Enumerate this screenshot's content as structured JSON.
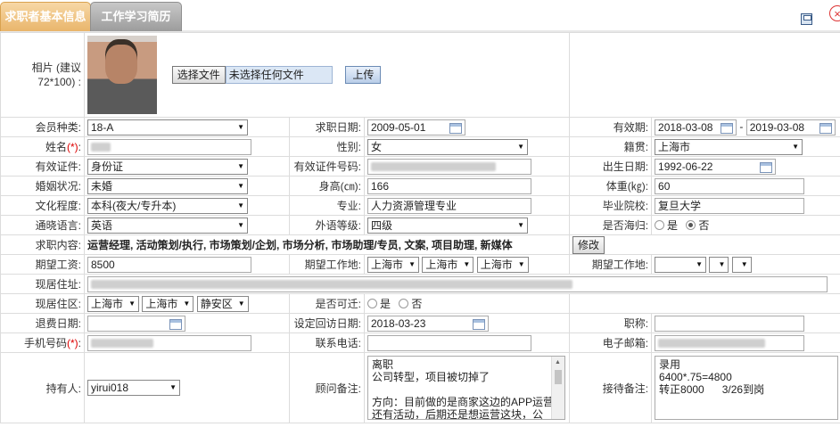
{
  "tabs": [
    "求职者基本信息",
    "工作学习简历"
  ],
  "photo": {
    "label": "相片 (建议72*100) :",
    "choose_btn": "选择文件",
    "no_file": "未选择任何文件",
    "upload_btn": "上传"
  },
  "labels": {
    "member_type": "会员种类:",
    "job_date": "求职日期:",
    "valid_period": "有效期:",
    "name": "姓名",
    "gender": "性别:",
    "native": "籍贯:",
    "id_type": "有效证件:",
    "id_no": "有效证件号码:",
    "birth": "出生日期:",
    "marital": "婚姻状况:",
    "height": "身高(㎝):",
    "weight": "体重(㎏):",
    "education": "文化程度:",
    "major": "专业:",
    "school": "毕业院校:",
    "language": "通晓语言:",
    "foreign_level": "外语等级:",
    "returnee": "是否海归:",
    "job_content": "求职内容:",
    "expect_salary": "期望工资:",
    "expect_place": "期望工作地:",
    "current_addr": "现居住址:",
    "current_area": "现居住区:",
    "relocate": "是否可迁:",
    "refund_date": "退费日期:",
    "callback_date": "设定回访日期:",
    "title": "职称:",
    "mobile": "手机号码",
    "phone": "联系电话:",
    "email": "电子邮箱:",
    "holder": "持有人:",
    "consultant_note": "顾问备注:",
    "reception_note": "接待备注:"
  },
  "values": {
    "member_type": "18-A",
    "job_date": "2009-05-01",
    "valid_from": "2018-03-08",
    "valid_to": "2019-03-08",
    "gender": "女",
    "native": "上海市",
    "id_type": "身份证",
    "birth": "1992-06-22",
    "marital": "未婚",
    "height": "166",
    "weight": "60",
    "education": "本科(夜大/专升本)",
    "major": "人力资源管理专业",
    "school": "复旦大学",
    "language": "英语",
    "foreign_level": "四级",
    "yes": "是",
    "no": "否",
    "job_content": "运营经理, 活动策划/执行, 市场策划/企划, 市场分析, 市场助理/专员, 文案, 项目助理, 新媒体",
    "modify_btn": "修改",
    "expect_salary": "8500",
    "city1": "上海市",
    "city2": "上海市",
    "city3": "上海市",
    "area_city1": "上海市",
    "area_city2": "上海市",
    "district": "静安区",
    "callback_date": "2018-03-23",
    "holder": "yirui018",
    "consultant_note": "离职\n公司转型，项目被切掉了\n\n方向：目前做的是商家这边的APP运营\n还有活动，后期还是想运营这块，公",
    "reception_note": "录用\n6400*.75=4800\n转正8000      3/26到岗",
    "required_mark": "(*)"
  }
}
